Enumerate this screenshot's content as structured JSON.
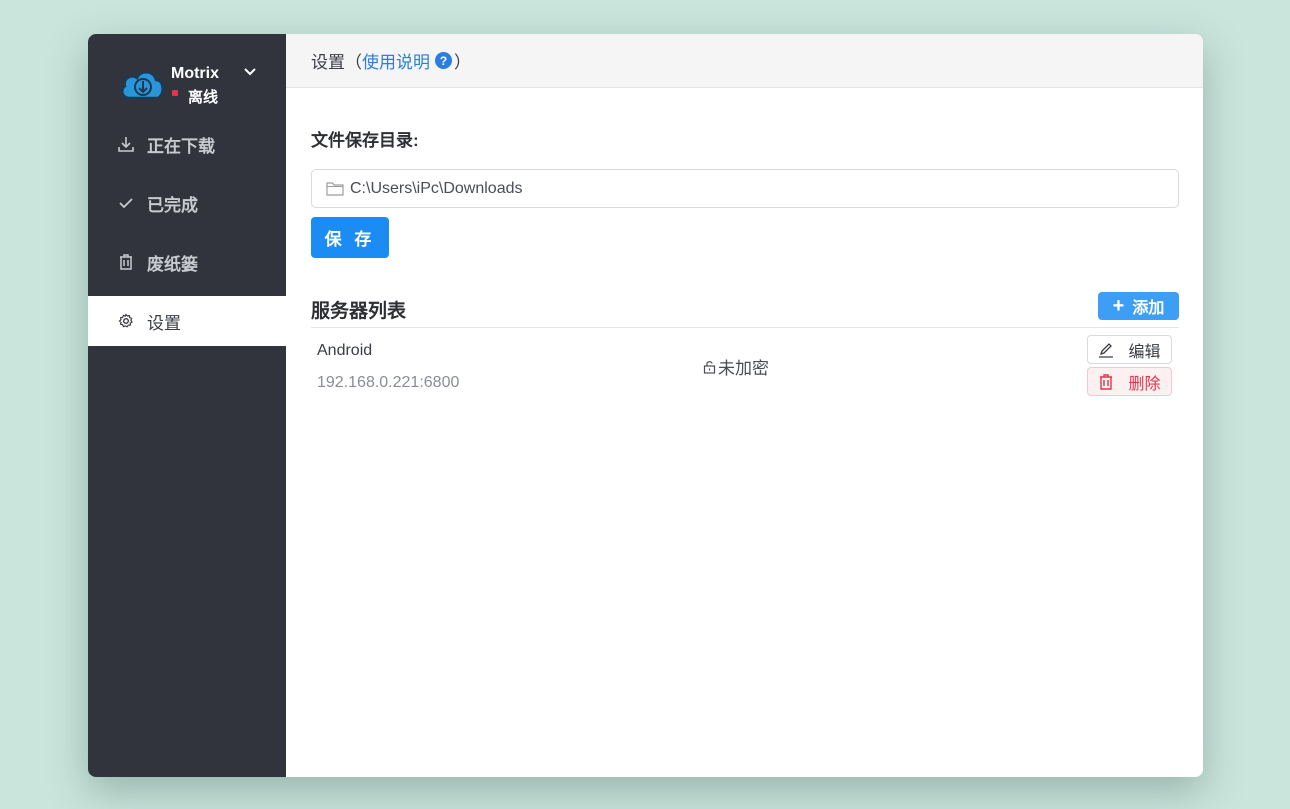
{
  "app": {
    "name": "Motrix",
    "status": "离线"
  },
  "sidebar": {
    "items": [
      {
        "label": "正在下载",
        "icon": "download-icon"
      },
      {
        "label": "已完成",
        "icon": "check-icon"
      },
      {
        "label": "废纸篓",
        "icon": "trash-icon"
      },
      {
        "label": "设置",
        "icon": "gear-icon",
        "active": true
      }
    ]
  },
  "header": {
    "title": "设置（",
    "help_link": "使用说明",
    "help_icon": "?",
    "close_paren": "）"
  },
  "settings": {
    "dir_label": "文件保存目录:",
    "dir_value": "C:\\Users\\iPc\\Downloads",
    "save_label": "保 存"
  },
  "servers": {
    "title": "服务器列表",
    "add_label": "添加",
    "list": [
      {
        "name": "Android",
        "address": "192.168.0.221:6800",
        "encryption": "未加密",
        "edit_label": "编辑",
        "delete_label": "删除"
      }
    ]
  },
  "colors": {
    "accent": "#1a8cf3",
    "sidebar_bg": "#31343d",
    "danger": "#e8324a",
    "page_bg": "#c9e5dc"
  }
}
